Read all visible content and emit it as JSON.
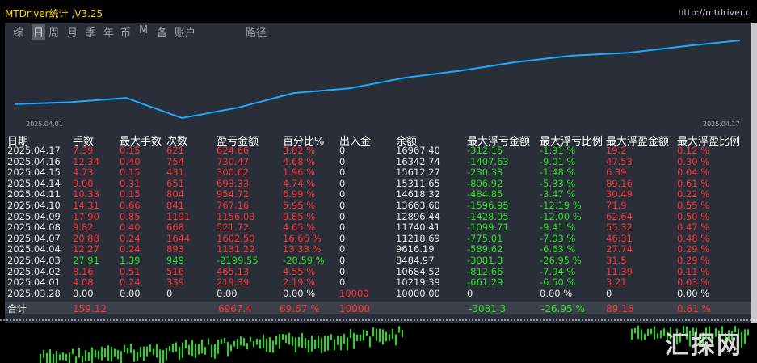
{
  "app": {
    "title": "MTDriver统计 ,V3.25",
    "url": "http://mtdriver.c",
    "watermark": "汇探网"
  },
  "tabs": [
    {
      "label": "综",
      "active": false
    },
    {
      "label": "日",
      "active": true
    },
    {
      "label": "周",
      "active": false
    },
    {
      "label": "月",
      "active": false
    },
    {
      "label": "季",
      "active": false
    },
    {
      "label": "年",
      "active": false
    },
    {
      "label": "币",
      "active": false
    },
    {
      "label": "M",
      "active": false
    },
    {
      "label": "备",
      "active": false
    },
    {
      "label": "账户",
      "active": false
    },
    {
      "label": "路径",
      "active": false
    }
  ],
  "chart_data": {
    "type": "line",
    "x_tick_labels": [
      "2025.04.01",
      "2025.04.17"
    ],
    "x": [
      "2025.03.28",
      "2025.04.01",
      "2025.04.02",
      "2025.04.03",
      "2025.04.04",
      "2025.04.07",
      "2025.04.08",
      "2025.04.09",
      "2025.04.10",
      "2025.04.11",
      "2025.04.14",
      "2025.04.15",
      "2025.04.16",
      "2025.04.17"
    ],
    "values": [
      10000.0,
      10219.39,
      10684.52,
      8484.97,
      9616.19,
      11218.69,
      11740.41,
      12896.44,
      13663.6,
      14618.32,
      15311.65,
      15612.27,
      16342.74,
      16967.4
    ],
    "line_color": "#1ea8ff",
    "grid": false
  },
  "table": {
    "headers": [
      "日期",
      "手数",
      "最大手数",
      "次数",
      "盈亏金额",
      "百分比%",
      "出入金",
      "余额",
      "最大浮亏金额",
      "最大浮亏比例",
      "最大浮盈金额",
      "最大浮盈比例"
    ],
    "rows": [
      {
        "date": "2025.04.17",
        "lots": "7.39",
        "max_lots": "0.15",
        "count": "621",
        "pnl": "624.66",
        "pct": "3.82 %",
        "io": "0",
        "balance": "16967.40",
        "mfl": "-312.15",
        "mflp": "-1.91 %",
        "mfp": "19.2",
        "mfpp": "0.12 %",
        "sign": "red"
      },
      {
        "date": "2025.04.16",
        "lots": "12.34",
        "max_lots": "0.40",
        "count": "754",
        "pnl": "730.47",
        "pct": "4.68 %",
        "io": "0",
        "balance": "16342.74",
        "mfl": "-1407.63",
        "mflp": "-9.01 %",
        "mfp": "47.53",
        "mfpp": "0.30 %",
        "sign": "red"
      },
      {
        "date": "2025.04.15",
        "lots": "4.73",
        "max_lots": "0.15",
        "count": "431",
        "pnl": "300.62",
        "pct": "1.96 %",
        "io": "0",
        "balance": "15612.27",
        "mfl": "-230.33",
        "mflp": "-1.48 %",
        "mfp": "6.39",
        "mfpp": "0.04 %",
        "sign": "red"
      },
      {
        "date": "2025.04.14",
        "lots": "9.00",
        "max_lots": "0.31",
        "count": "651",
        "pnl": "693.33",
        "pct": "4.74 %",
        "io": "0",
        "balance": "15311.65",
        "mfl": "-806.92",
        "mflp": "-5.33 %",
        "mfp": "89.16",
        "mfpp": "0.61 %",
        "sign": "red"
      },
      {
        "date": "2025.04.11",
        "lots": "10.33",
        "max_lots": "0.15",
        "count": "804",
        "pnl": "954.72",
        "pct": "6.99 %",
        "io": "0",
        "balance": "14618.32",
        "mfl": "-484.85",
        "mflp": "-3.47 %",
        "mfp": "30.49",
        "mfpp": "0.22 %",
        "sign": "red"
      },
      {
        "date": "2025.04.10",
        "lots": "14.31",
        "max_lots": "0.66",
        "count": "841",
        "pnl": "767.16",
        "pct": "5.95 %",
        "io": "0",
        "balance": "13663.60",
        "mfl": "-1596.95",
        "mflp": "-12.19 %",
        "mfp": "71.9",
        "mfpp": "0.55 %",
        "sign": "red"
      },
      {
        "date": "2025.04.09",
        "lots": "17.90",
        "max_lots": "0.85",
        "count": "1191",
        "pnl": "1156.03",
        "pct": "9.85 %",
        "io": "0",
        "balance": "12896.44",
        "mfl": "-1428.95",
        "mflp": "-12.00 %",
        "mfp": "62.64",
        "mfpp": "0.50 %",
        "sign": "red"
      },
      {
        "date": "2025.04.08",
        "lots": "9.82",
        "max_lots": "0.40",
        "count": "668",
        "pnl": "521.72",
        "pct": "4.65 %",
        "io": "0",
        "balance": "11740.41",
        "mfl": "-1099.71",
        "mflp": "-9.41 %",
        "mfp": "55.32",
        "mfpp": "0.47 %",
        "sign": "red"
      },
      {
        "date": "2025.04.07",
        "lots": "20.88",
        "max_lots": "0.24",
        "count": "1644",
        "pnl": "1602.50",
        "pct": "16.66 %",
        "io": "0",
        "balance": "11218.69",
        "mfl": "-775.01",
        "mflp": "-7.03 %",
        "mfp": "46.31",
        "mfpp": "0.48 %",
        "sign": "red"
      },
      {
        "date": "2025.04.04",
        "lots": "12.27",
        "max_lots": "0.24",
        "count": "893",
        "pnl": "1131.22",
        "pct": "13.33 %",
        "io": "0",
        "balance": "9616.19",
        "mfl": "-589.62",
        "mflp": "-6.63 %",
        "mfp": "27.74",
        "mfpp": "0.29 %",
        "sign": "red"
      },
      {
        "date": "2025.04.03",
        "lots": "27.91",
        "max_lots": "1.39",
        "count": "949",
        "pnl": "-2199.55",
        "pct": "-20.59 %",
        "io": "0",
        "balance": "8484.97",
        "mfl": "-3081.3",
        "mflp": "-26.95 %",
        "mfp": "31.5",
        "mfpp": "0.29 %",
        "sign": "green"
      },
      {
        "date": "2025.04.02",
        "lots": "8.16",
        "max_lots": "0.51",
        "count": "516",
        "pnl": "465.13",
        "pct": "4.55 %",
        "io": "0",
        "balance": "10684.52",
        "mfl": "-812.66",
        "mflp": "-7.94 %",
        "mfp": "11.39",
        "mfpp": "0.11 %",
        "sign": "red"
      },
      {
        "date": "2025.04.01",
        "lots": "4.08",
        "max_lots": "0.24",
        "count": "339",
        "pnl": "219.39",
        "pct": "2.19 %",
        "io": "0",
        "balance": "10219.39",
        "mfl": "-661.29",
        "mflp": "-6.50 %",
        "mfp": "3.21",
        "mfpp": "0.03 %",
        "sign": "red"
      },
      {
        "date": "2025.03.28",
        "lots": "0.00",
        "max_lots": "0.00",
        "count": "0",
        "pnl": "0.00",
        "pct": "0.00 %",
        "io": "10000",
        "balance": "10000.00",
        "mfl": "0",
        "mflp": "0.00 %",
        "mfp": "0",
        "mfpp": "0.00 %",
        "sign": "white"
      }
    ],
    "total": {
      "label": "合计",
      "lots": "159.12",
      "pnl": "6967.4",
      "pct": "69.67 %",
      "io": "10000",
      "mfl": "-3081.3",
      "mflp": "-26.95 %",
      "mfp": "89.16",
      "mfpp": "0.61 %"
    }
  }
}
